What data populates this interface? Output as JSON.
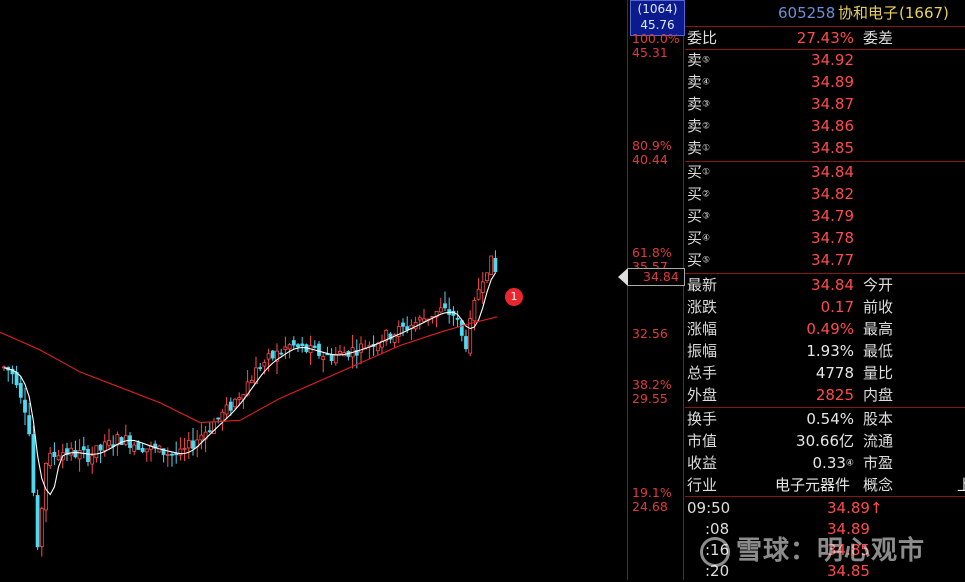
{
  "top_box": {
    "line1": "(1064)",
    "line2": "45.76"
  },
  "axis_labels": [
    {
      "pct": "100.0%",
      "price": "45.31"
    },
    {
      "pct": "80.9%",
      "price": "40.44"
    },
    {
      "pct": "61.8%",
      "price": "35.57"
    },
    {
      "pct": "",
      "price": "32.56"
    },
    {
      "pct": "38.2%",
      "price": "29.55"
    },
    {
      "pct": "19.1%",
      "price": "24.68"
    }
  ],
  "current_price_flag": "34.84",
  "marker_badge": "1",
  "stock": {
    "code": "605258",
    "name": "协和电子",
    "extra": "(1667)"
  },
  "weibi": {
    "label": "委比",
    "value": "27.43%",
    "label2": "委差"
  },
  "sell": [
    {
      "label": "卖",
      "idx": "⑤",
      "price": "34.92"
    },
    {
      "label": "卖",
      "idx": "④",
      "price": "34.89"
    },
    {
      "label": "卖",
      "idx": "③",
      "price": "34.87"
    },
    {
      "label": "卖",
      "idx": "②",
      "price": "34.86"
    },
    {
      "label": "卖",
      "idx": "①",
      "price": "34.85"
    }
  ],
  "buy": [
    {
      "label": "买",
      "idx": "①",
      "price": "34.84"
    },
    {
      "label": "买",
      "idx": "②",
      "price": "34.82"
    },
    {
      "label": "买",
      "idx": "③",
      "price": "34.79"
    },
    {
      "label": "买",
      "idx": "④",
      "price": "34.78"
    },
    {
      "label": "买",
      "idx": "⑤",
      "price": "34.77"
    }
  ],
  "quote": [
    {
      "label": "最新",
      "value": "34.84",
      "label2": "今开",
      "color": "red"
    },
    {
      "label": "涨跌",
      "value": "0.17",
      "label2": "前收",
      "color": "red"
    },
    {
      "label": "涨幅",
      "value": "0.49%",
      "label2": "最高",
      "color": "red"
    },
    {
      "label": "振幅",
      "value": "1.93%",
      "label2": "最低",
      "color": "white"
    },
    {
      "label": "总手",
      "value": "4778",
      "label2": "量比",
      "color": "white"
    },
    {
      "label": "外盘",
      "value": "2825",
      "label2": "内盘",
      "color": "red"
    }
  ],
  "fundamentals": [
    {
      "label": "换手",
      "value": "0.54%",
      "label2": "股本",
      "color": "white"
    },
    {
      "label": "市值",
      "value": "30.66亿",
      "label2": "流通",
      "color": "white"
    },
    {
      "label": "收益",
      "value": "0.33",
      "suffix": "④",
      "label2": "市盈",
      "color": "white"
    }
  ],
  "industry": {
    "label": "行业",
    "value": "电子元器件",
    "label2": "概念",
    "extra": "上"
  },
  "ticks": [
    {
      "time": "09:50",
      "price": "34.89↑"
    },
    {
      "time": ":08",
      "price": "34.89"
    },
    {
      "time": ":16",
      "price": "34.85"
    },
    {
      "time": ":20",
      "price": "34.85"
    }
  ],
  "watermark": "雪球：明心观市",
  "colors": {
    "up": "#ff4b4b",
    "down": "#4fd8f0",
    "ma_short": "#ffffff",
    "ma_long": "#e02020",
    "grid": "#8a1515"
  }
}
